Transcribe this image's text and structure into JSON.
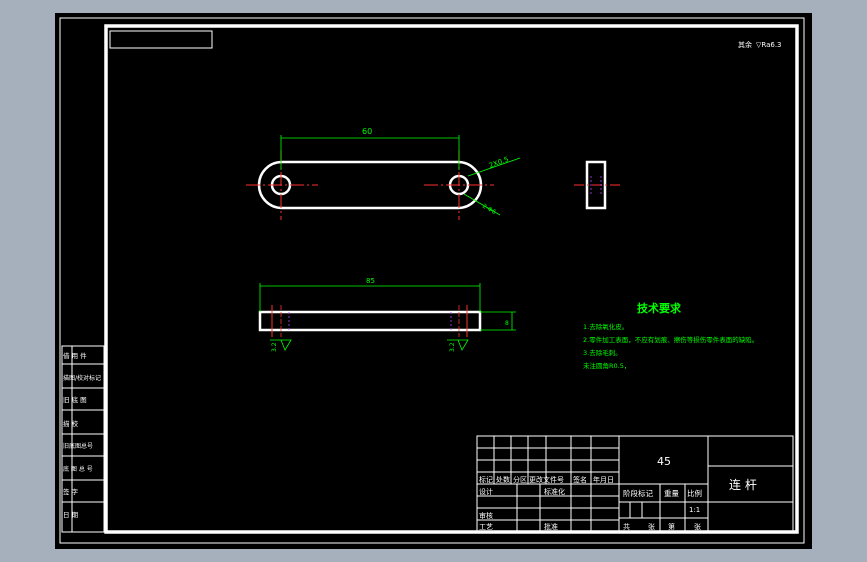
{
  "drawing": {
    "roughness_note": "其余",
    "roughness_symbol": "▽Ra6.3",
    "dimensions": {
      "hole_spacing": "60",
      "chamfer": "2X0.5",
      "hole_callout": "2-Φ6",
      "length": "85",
      "thickness": "8",
      "hole_depth_left": "3.2",
      "hole_depth_right": "3.2"
    }
  },
  "technical_requirements": {
    "heading": "技术要求",
    "items": [
      "1.去除氧化皮。",
      "2.零件加工表面，不应有划痕、擦伤等损伤零件表面的缺陷。",
      "3.去除毛刺。",
      "未注圆角R0.5，"
    ]
  },
  "left_panel": {
    "cells": [
      "借 用 件",
      "描图/校对标记",
      "旧 底 图",
      "描 校",
      "旧底图总号",
      "底 图 总 号",
      "签 字",
      "日 期"
    ]
  },
  "title_block": {
    "material": "45",
    "part_name": "连 杆",
    "labels": {
      "mark": "标记",
      "count": "处数",
      "zone": "分区",
      "change_doc": "更改文件号",
      "sign": "签名",
      "date": "年月日",
      "design": "设计",
      "standardize": "标准化",
      "check": "审核",
      "process": "工艺",
      "approve": "批准",
      "stage_mark": "阶段标记",
      "weight": "重量",
      "scale": "比例",
      "sheets_total": "共",
      "sheets_unit": "张",
      "sheet_no": "第",
      "sheet_unit2": "张"
    },
    "scale_value": "1:1"
  }
}
